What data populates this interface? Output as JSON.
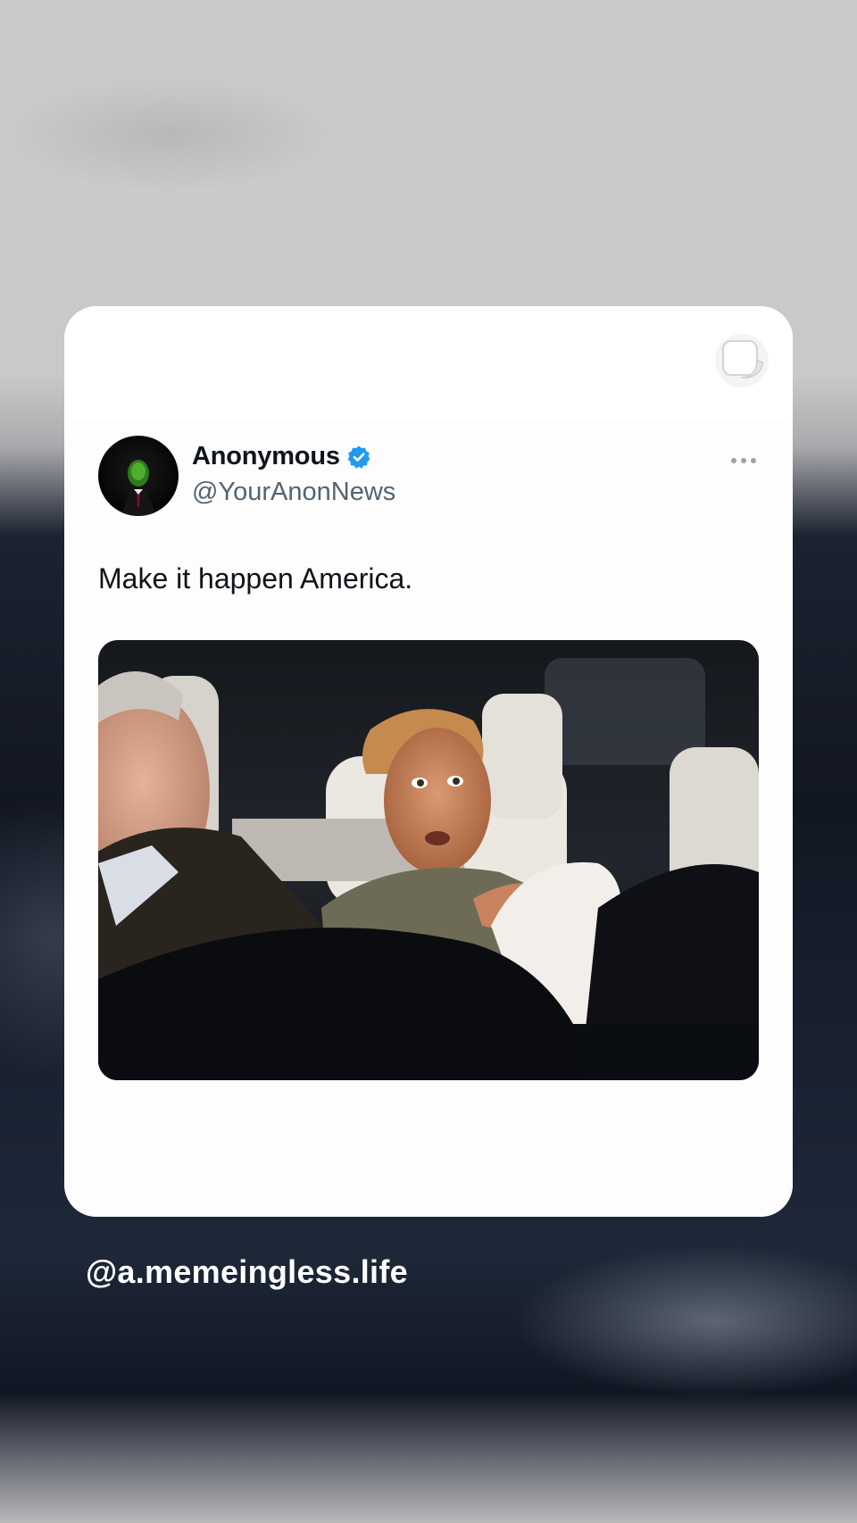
{
  "tweet": {
    "author_name": "Anonymous",
    "author_handle": "@YourAnonNews",
    "text": "Make it happen America.",
    "verified": true
  },
  "story": {
    "username": "@a.memeingless.life"
  },
  "icons": {
    "sticker": "sticker-icon",
    "more": "more-options-icon",
    "verified": "verified-badge-icon"
  },
  "colors": {
    "verified_blue": "#1d9bf0",
    "handle_gray": "#536471",
    "text_dark": "#0f1419"
  }
}
